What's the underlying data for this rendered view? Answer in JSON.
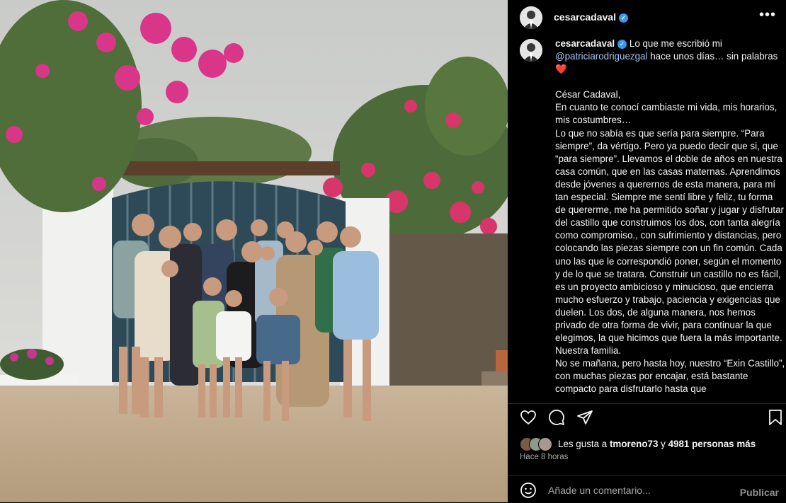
{
  "post": {
    "username": "cesarcadaval",
    "verified_icon": "verified-badge-icon",
    "more_icon": "more-options-icon"
  },
  "caption": {
    "username": "cesarcadaval",
    "intro_1": "Lo que me escribió mi",
    "mention": "@patriciarodriguezgal",
    "intro_2": "hace unos días… sin palabras",
    "heart": "❤️",
    "greeting": "César Cadaval,",
    "body": "En cuanto te conocí cambiaste mi vida, mis horarios, mis costumbres…\nLo que no sabía es que sería para siempre. “Para siempre”, da vértigo. Pero ya puedo decir que si, que “para siempre”. Llevamos el doble de años en nuestra casa común, que en las casas maternas. Aprendimos desde jóvenes a querernos de esta manera, para mí tan especial. Siempre me sentí libre y feliz, tu forma de quererme, me ha permitido soñar y jugar y disfrutar del castillo que construimos los dos, con tanta alegría como compromiso., con sufrimiento y distancias, pero colocando las piezas siempre con un fin común. Cada uno las que le correspondió poner, según el momento y de lo que se tratara. Construir un castillo no es fácil, es un proyecto ambicioso y minucioso, que encierra mucho esfuerzo y trabajo, paciencia y exigencias que duelen. Los dos, de alguna manera, nos hemos privado de otra forma de vivir, para continuar la que elegimos, la que hicimos que fuera la más importante. Nuestra familia.\nNo se mañana, pero hasta hoy, nuestro “Exin Castillo”, con muchas piezas por encajar, está bastante compacto para disfrutarlo hasta que"
  },
  "actions": {
    "like_icon": "heart-icon",
    "comment_icon": "comment-icon",
    "share_icon": "share-icon",
    "save_icon": "bookmark-icon"
  },
  "likes": {
    "prefix": "Les gusta a ",
    "user": "tmoreno73",
    "middle": " y ",
    "count": "4981 personas más"
  },
  "timestamp": "Hace 8 horas",
  "comment": {
    "placeholder": "Añade un comentario...",
    "publish_label": "Publicar",
    "emoji_icon": "emoji-icon"
  },
  "colors": {
    "background": "#000000",
    "text": "#f5f5f5",
    "mention": "#a7c6f5",
    "verified": "#3897f0",
    "secondary_text": "#a8a8a8"
  }
}
